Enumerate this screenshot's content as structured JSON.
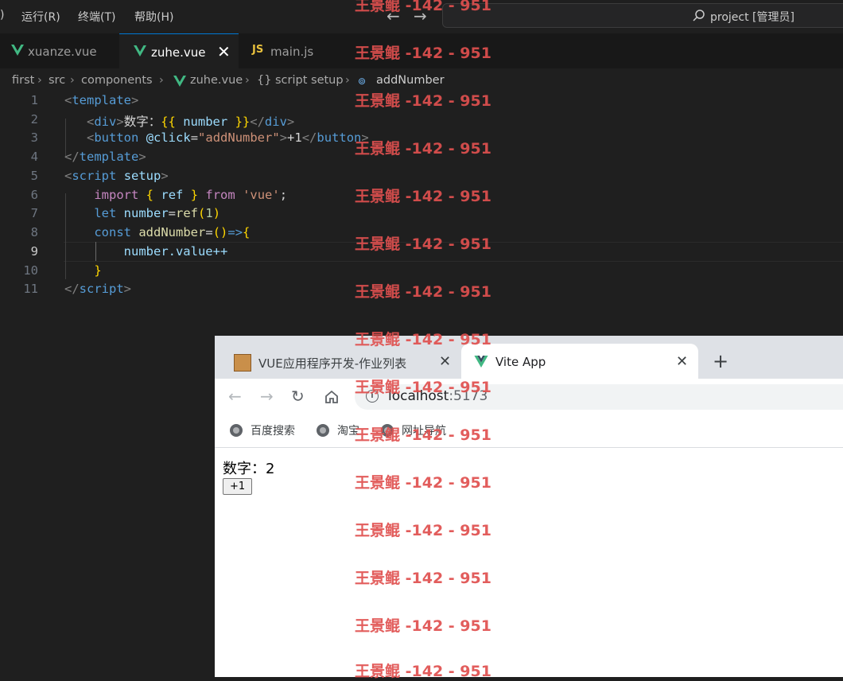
{
  "vscode": {
    "menu": [
      ")",
      "运行(R)",
      "终端(T)",
      "帮助(H)"
    ],
    "command_center": "project [管理员]",
    "tabs": [
      {
        "label": "xuanze.vue",
        "icon": "vue-icon"
      },
      {
        "label": "zuhe.vue",
        "icon": "vue-icon",
        "active": true
      },
      {
        "label": "main.js",
        "icon": "js-icon"
      }
    ],
    "js_badge": "JS",
    "breadcrumb": [
      "first",
      "src",
      "components",
      "zuhe.vue",
      "script setup",
      "addNumber"
    ],
    "current_line": 9,
    "line_numbers": [
      "1",
      "2",
      "3",
      "4",
      "5",
      "6",
      "7",
      "8",
      "9",
      "10",
      "11"
    ],
    "code_tokens": {
      "template": "template",
      "div": "div",
      "div_text": "数字：",
      "number": "number",
      "button": "button",
      "click_attr": "@click",
      "add_number_str": "\"addNumber\"",
      "plus_one": "+1",
      "script": "script",
      "setup": "setup",
      "import": "import",
      "ref": "ref",
      "from": "from",
      "vue_str": "'vue'",
      "let": "let",
      "ref_call": "ref",
      "one": "1",
      "const": "const",
      "addNumber": "addNumber",
      "value_expr": "number.value++"
    },
    "colors": {
      "background": "#1f1f1f",
      "accent": "#0078d4"
    }
  },
  "browser": {
    "tabs": [
      {
        "label": "VUE应用程序开发-作业列表",
        "icon": "site-favicon"
      },
      {
        "label": "Vite App",
        "icon": "vue-icon",
        "active": true
      }
    ],
    "url_host": "localhost",
    "url_port": ":5173",
    "bookmarks": [
      "百度搜索",
      "淘宝",
      "网址导航"
    ],
    "page": {
      "number_text": "数字：2",
      "button_label": "+1"
    }
  },
  "watermark": "王景鲲 -142 - 951"
}
